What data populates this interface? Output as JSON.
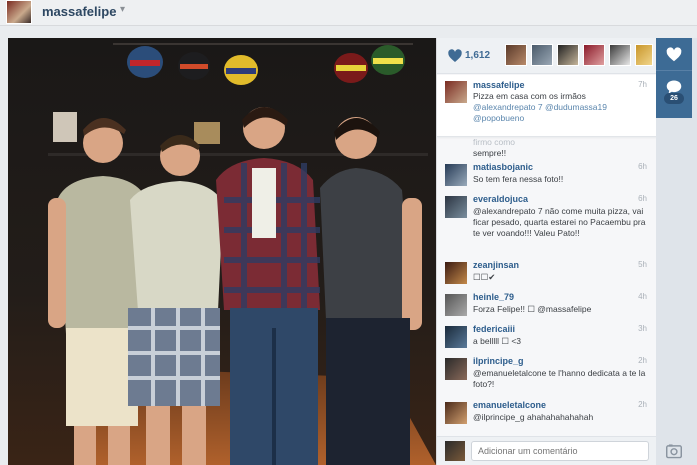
{
  "header": {
    "username": "massafelipe",
    "caret": "▾",
    "avatar_icon": "user-avatar"
  },
  "likes": {
    "count": "1,612",
    "color": "#3f6b94"
  },
  "caption": {
    "user": "massafelipe",
    "time": "7h",
    "text": "Pizza em casa com os irmãos",
    "mentions": "@alexandrepato 7 @dudumassa19 @popobueno"
  },
  "partial_comment": {
    "text": "sempre!!",
    "prefix": "firmo como"
  },
  "comments": [
    {
      "user": "matiasbojanic",
      "time": "6h",
      "text": "So tem fera nessa foto!!"
    },
    {
      "user": "everaldojuca",
      "time": "6h",
      "text": "@alexandrepato 7 não come muita pizza, vai ficar pesado, quarta estarei no Pacaembu pra te ver voando!!! Valeu Pato!!"
    },
    {
      "user": "zeanjinsan",
      "time": "5h",
      "text": "☐☐✔"
    },
    {
      "user": "heinle_79",
      "time": "4h",
      "text": "Forza Felipe!! ☐ @massafelipe"
    },
    {
      "user": "federicaiii",
      "time": "3h",
      "text": "a belllll ☐ <3"
    },
    {
      "user": "ilprincipe_g",
      "time": "2h",
      "text": "@emanueletalcone te l'hanno dedicata a te la foto?!"
    },
    {
      "user": "emanueletalcone",
      "time": "2h",
      "text": "@ilprincipe_g ahahahahahahah"
    }
  ],
  "input": {
    "placeholder": "Adicionar um comentário"
  },
  "rail": {
    "comment_count": "26",
    "accent": "#3d6b95"
  }
}
